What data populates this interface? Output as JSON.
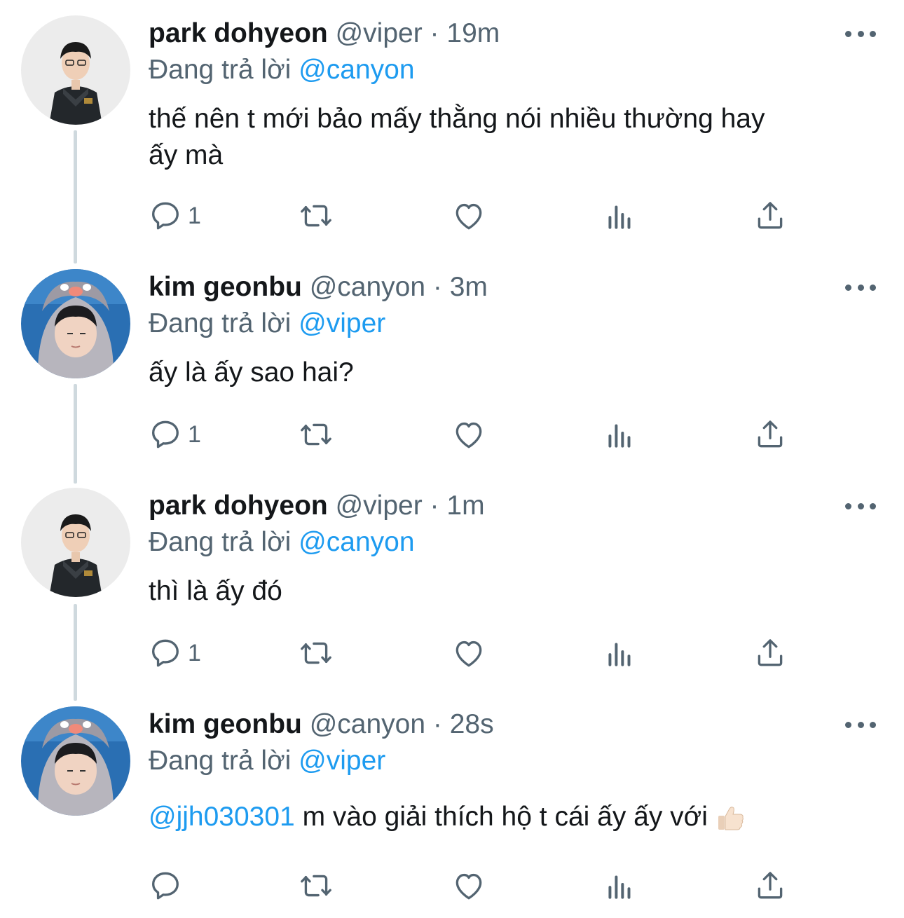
{
  "colors": {
    "link": "#1d9bf0",
    "muted": "#536471",
    "text": "#14171a",
    "thread_line": "#cfd9de"
  },
  "tweets": [
    {
      "name": "park dohyeon",
      "handle": "@viper",
      "sep": "·",
      "time": "19m",
      "reply_prefix": "Đang trả lời",
      "reply_to": "@canyon",
      "text_line1": "thế nên t mới bảo mấy thằng nói nhiều thường hay",
      "text_line2": "ấy mà",
      "reply_count": "1",
      "avatar_icon": "viper-avatar"
    },
    {
      "name": "kim geonbu",
      "handle": "@canyon",
      "sep": "·",
      "time": "3m",
      "reply_prefix": "Đang trả lời",
      "reply_to": "@viper",
      "text_line1": "ấy là ấy sao hai?",
      "reply_count": "1",
      "avatar_icon": "canyon-avatar"
    },
    {
      "name": "park dohyeon",
      "handle": "@viper",
      "sep": "·",
      "time": "1m",
      "reply_prefix": "Đang trả lời",
      "reply_to": "@canyon",
      "text_line1": "thì là ấy đó",
      "reply_count": "1",
      "avatar_icon": "viper-avatar"
    },
    {
      "name": "kim geonbu",
      "handle": "@canyon",
      "sep": "·",
      "time": "28s",
      "reply_prefix": "Đang trả lời",
      "reply_to": "@viper",
      "text_mention": "@jjh030301",
      "text_rest": " m vào giải thích hộ t cái ấy ấy với ",
      "emoji": "thumbs-up-icon",
      "reply_count": "",
      "avatar_icon": "canyon-avatar"
    }
  ]
}
